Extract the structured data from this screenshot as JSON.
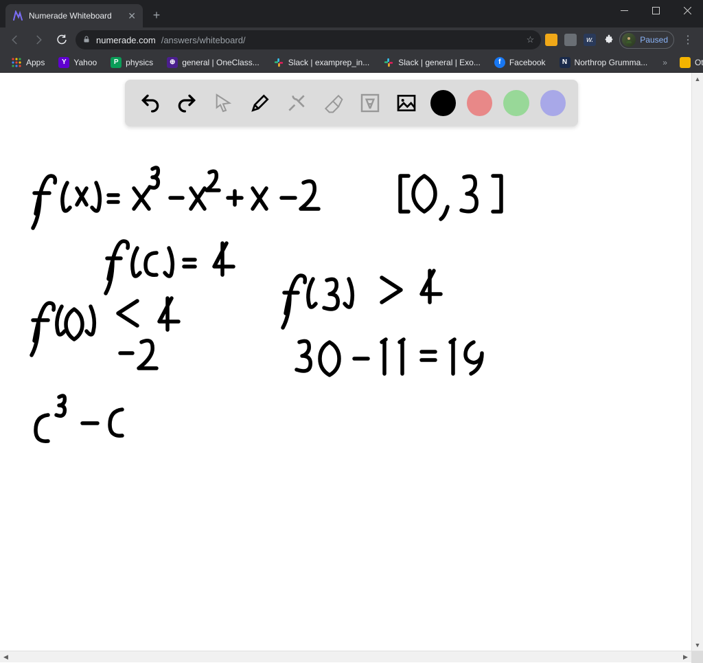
{
  "window": {
    "title_bar_color": "#202124"
  },
  "tab": {
    "title": "Numerade Whiteboard",
    "favicon_color": "#5a4fcf"
  },
  "url": {
    "host": "numerade.com",
    "path": "/answers/whiteboard/"
  },
  "profile": {
    "label": "Paused"
  },
  "bookmarks": {
    "items": [
      {
        "label": "Apps",
        "icon_bg": "transparent"
      },
      {
        "label": "Yahoo",
        "icon_bg": "#5f01d1"
      },
      {
        "label": "physics",
        "icon_bg": "#0a9d58"
      },
      {
        "label": "general | OneClass...",
        "icon_bg": "#4b1f8e"
      },
      {
        "label": "Slack | examprep_in...",
        "icon_bg": "#222"
      },
      {
        "label": "Slack | general | Exo...",
        "icon_bg": "#222"
      },
      {
        "label": "Facebook",
        "icon_bg": "#1877f2"
      },
      {
        "label": "Northrop Grumma...",
        "icon_bg": "#1a2a4a"
      }
    ],
    "other_label": "Other bookmarks"
  },
  "toolbar": {
    "tools": {
      "undo": "undo",
      "redo": "redo",
      "pointer": "pointer",
      "pen": "pen",
      "fixup": "fixup",
      "eraser": "eraser",
      "text": "text",
      "image": "image"
    },
    "colors": {
      "black": "#000000",
      "red": "#e88888",
      "green": "#98d898",
      "purple": "#a8a8e8"
    },
    "active_color": "black"
  },
  "handwriting": {
    "line1": "f(x) = x³ − x² + x − 2      [0, 3]",
    "line2": "f(c) = 4",
    "line3a": "f(0) < 4",
    "line3b": "−2",
    "line4a": "f(3) > 4",
    "line4b": "30 − 11 = 19",
    "line5": "c³ − c"
  }
}
